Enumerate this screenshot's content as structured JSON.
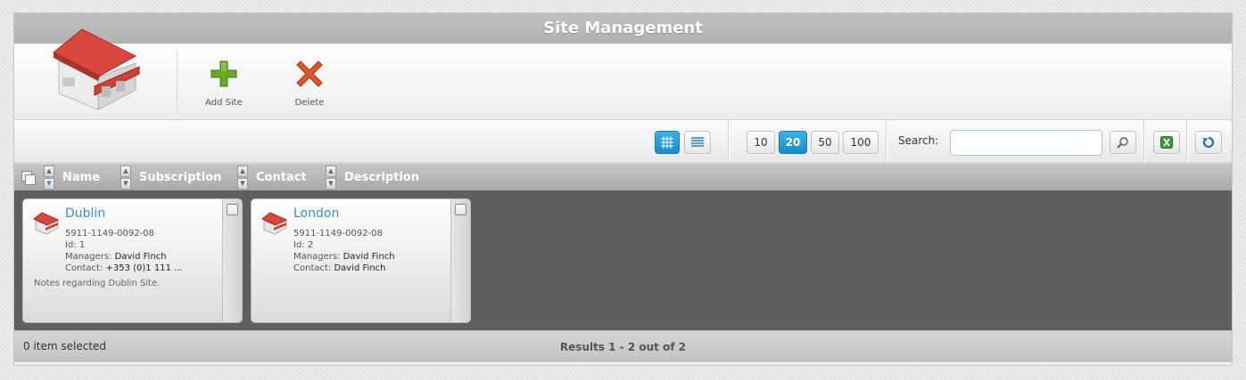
{
  "window": {
    "title": "Site Management"
  },
  "toolbar": {
    "add_label": "Add Site",
    "delete_label": "Delete"
  },
  "view": {
    "page_sizes": [
      "10",
      "20",
      "50",
      "100"
    ],
    "active_page_size": "20",
    "search_label": "Search:",
    "search_value": ""
  },
  "columns": [
    "Name",
    "Subscription",
    "Contact",
    "Description"
  ],
  "cards": [
    {
      "name": "Dublin",
      "subscription": "5911-1149-0092-08",
      "id_label": "Id:",
      "id": "1",
      "managers_label": "Managers:",
      "managers": "David Finch",
      "contact_label": "Contact:",
      "contact": "+353 (0)1 111 ...",
      "notes": "Notes regarding Dublin Site."
    },
    {
      "name": "London",
      "subscription": "5911-1149-0092-08",
      "id_label": "Id:",
      "id": "2",
      "managers_label": "Managers:",
      "managers": "David Finch",
      "contact_label": "Contact:",
      "contact": "David Finch",
      "notes": ""
    }
  ],
  "footer": {
    "selected_text": "0 item selected",
    "results_text": "Results 1 - 2 out of 2"
  },
  "colors": {
    "accent": "#1a93d0",
    "link": "#3a8fbf",
    "add": "#6aa82a",
    "delete": "#e0572a",
    "content_bg": "#5f5f5f"
  },
  "icons": [
    "warehouse-icon",
    "add-icon",
    "delete-icon",
    "grid-view-icon",
    "list-view-icon",
    "search-icon",
    "excel-icon",
    "refresh-icon",
    "select-all-icon",
    "checkbox-icon"
  ]
}
